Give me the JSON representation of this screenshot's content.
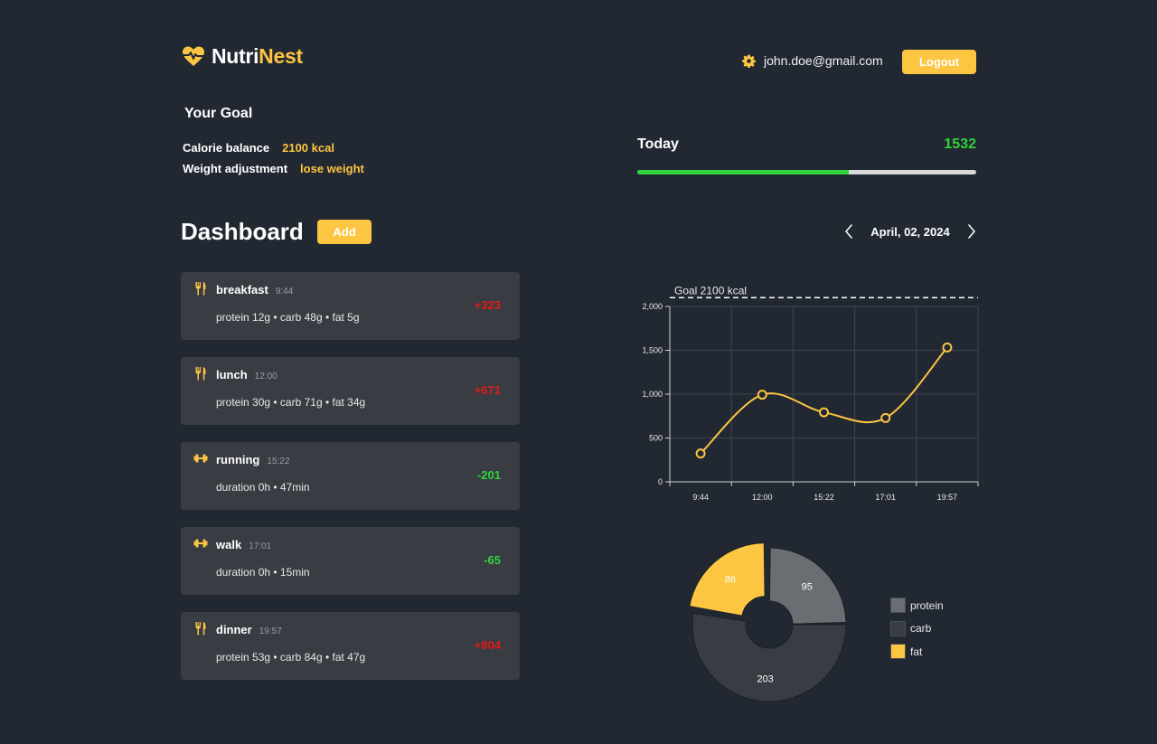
{
  "header": {
    "brand_part1": "Nutri",
    "brand_part2": "Nest",
    "user_email": "john.doe@gmail.com",
    "logout_label": "Logout"
  },
  "goal": {
    "title": "Your Goal",
    "calorie_label": "Calorie balance",
    "calorie_value": "2100 kcal",
    "weight_label": "Weight adjustment",
    "weight_value": "lose weight"
  },
  "today": {
    "label": "Today",
    "value": "1532",
    "progress_fraction": 0.624
  },
  "dashboard": {
    "title": "Dashboard",
    "add_label": "Add",
    "date": "April, 02, 2024"
  },
  "entries": [
    {
      "name": "breakfast",
      "time": "9:44",
      "detail": "protein 12g • carb 48g • fat 5g",
      "value": "+323",
      "kind": "meal",
      "sign": "pos"
    },
    {
      "name": "lunch",
      "time": "12:00",
      "detail": "protein 30g • carb 71g • fat 34g",
      "value": "+671",
      "kind": "meal",
      "sign": "pos"
    },
    {
      "name": "running",
      "time": "15:22",
      "detail": "duration 0h • 47min",
      "value": "-201",
      "kind": "exercise",
      "sign": "neg"
    },
    {
      "name": "walk",
      "time": "17:01",
      "detail": "duration 0h • 15min",
      "value": "-65",
      "kind": "exercise",
      "sign": "neg"
    },
    {
      "name": "dinner",
      "time": "19:57",
      "detail": "protein 53g • carb 84g • fat 47g",
      "value": "+804",
      "kind": "meal",
      "sign": "pos"
    }
  ],
  "icons": {
    "brand": "heart-pulse-icon",
    "settings": "gear-icon",
    "meal": "fork-knife-icon",
    "exercise": "dumbbell-icon",
    "prev": "chevron-left-icon",
    "next": "chevron-right-icon"
  },
  "colors": {
    "background": "#222832",
    "card": "#393c42",
    "accent": "#fcc542",
    "positive_green": "#30d33b",
    "negative_red": "#e01b1b",
    "protein": "#6a6d72",
    "carb": "#393c42",
    "fat": "#fcc542"
  },
  "chart_data": [
    {
      "type": "line",
      "x": [
        "9:44",
        "12:00",
        "15:22",
        "17:01",
        "19:57"
      ],
      "y": [
        323,
        994,
        793,
        728,
        1532
      ],
      "ylim": [
        0,
        2000
      ],
      "yticks": [
        0,
        500,
        1000,
        1500,
        2000
      ],
      "ytick_labels": [
        "0",
        "500",
        "1,000",
        "1,500",
        "2,000"
      ],
      "goal_line": {
        "value": 2100,
        "label": "Goal 2100 kcal"
      },
      "grid": true,
      "title": "",
      "xlabel": "",
      "ylabel": ""
    },
    {
      "type": "pie",
      "labels": [
        "protein",
        "carb",
        "fat"
      ],
      "values": [
        95,
        203,
        86
      ],
      "colors": [
        "#6a6d72",
        "#393c42",
        "#fcc542"
      ],
      "donut": true,
      "legend": "right"
    }
  ]
}
